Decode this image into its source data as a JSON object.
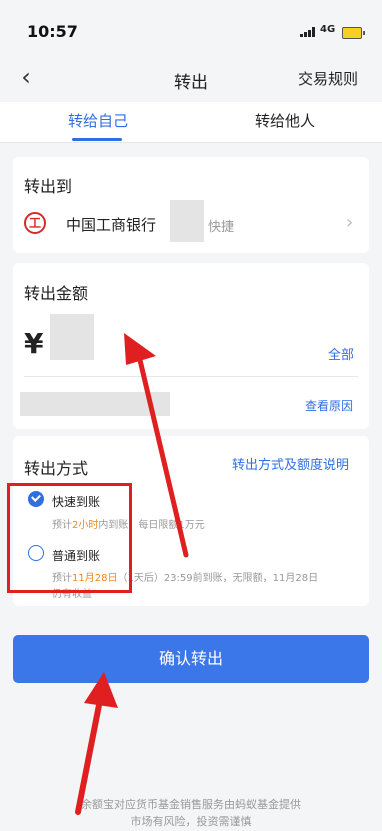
{
  "status": {
    "time": "10:57",
    "network": "4G"
  },
  "nav": {
    "title": "转出",
    "right_link": "交易规则"
  },
  "tabs": {
    "self": "转给自己",
    "other": "转给他人"
  },
  "destination": {
    "label": "转出到",
    "bank_name": "中国工商银行",
    "tag": "快捷",
    "logo_glyph": "工"
  },
  "amount": {
    "label": "转出金额",
    "currency": "¥",
    "all_link": "全部",
    "reason_link": "查看原因"
  },
  "method": {
    "label": "转出方式",
    "help_link": "转出方式及额度说明",
    "fast": {
      "title": "快速到账",
      "desc_pre": "预计",
      "desc_hl": "2小时",
      "desc_post": "内到账，每日限额1万元"
    },
    "normal": {
      "title": "普通到账",
      "desc_pre": "预计",
      "desc_hl": "11月28日",
      "desc_post": "（1天后）23:59前到账，无限额，11月28日",
      "desc_line2": "仍有收益"
    }
  },
  "confirm_button": "确认转出",
  "footer": {
    "line1": "余额宝对应货币基金销售服务由蚂蚁基金提供",
    "line2": "市场有风险，投资需谨慎"
  },
  "colors": {
    "accent": "#2f6fe0",
    "annotation": "#e02020"
  }
}
